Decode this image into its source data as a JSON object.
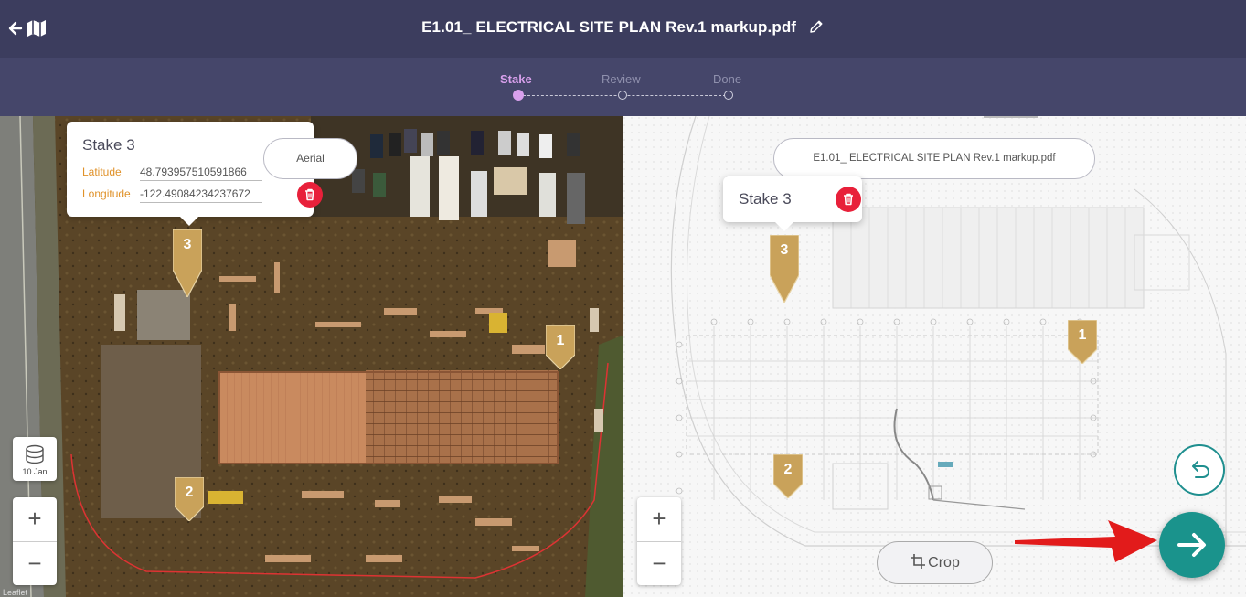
{
  "header": {
    "title": "E1.01_ ELECTRICAL SITE PLAN Rev.1 markup.pdf",
    "back_icon": "arrow-left-icon",
    "map_icon": "map-icon",
    "edit_icon": "pencil-icon"
  },
  "steps": [
    {
      "label": "Stake",
      "active": true
    },
    {
      "label": "Review",
      "active": false
    },
    {
      "label": "Done",
      "active": false
    }
  ],
  "left_map": {
    "popup": {
      "title": "Stake 3",
      "latitude_label": "Latitude",
      "latitude_value": "48.793957510591866",
      "longitude_label": "Longitude",
      "longitude_value": "-122.49084234237672"
    },
    "layer_toggle": "Aerial",
    "layers_date": "10 Jan",
    "markers": [
      "3",
      "1",
      "2"
    ],
    "zoom_in": "+",
    "zoom_out": "−",
    "attribution": "Leaflet"
  },
  "right_map": {
    "popup": {
      "title": "Stake 3"
    },
    "layer_toggle": "E1.01_ ELECTRICAL SITE PLAN Rev.1 markup.pdf",
    "markers": [
      "3",
      "1",
      "2"
    ],
    "zoom_in": "+",
    "zoom_out": "−",
    "crop_label": "Crop"
  },
  "colors": {
    "header_bg": "#3c3d5e",
    "stepbar_bg": "#45466a",
    "active_step": "#d8a0ec",
    "marker": "#c9a25a",
    "delete": "#e8203a",
    "primary": "#1a938c",
    "arrow_annotation": "#e21b1b"
  }
}
